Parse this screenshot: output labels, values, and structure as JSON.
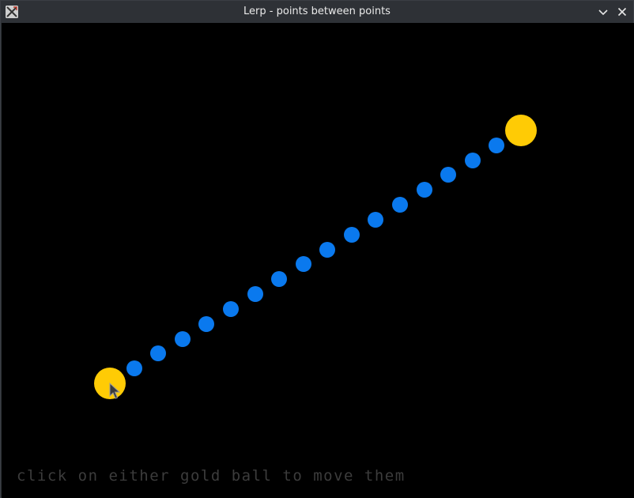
{
  "window": {
    "title": "Lerp - points between points"
  },
  "icons": {
    "app": "x11-app-icon",
    "minimize": "chevron-down-icon",
    "close": "close-icon"
  },
  "game": {
    "background_color": "#000000",
    "gold_color": "#ffcb05",
    "blue_color": "#0a79ee",
    "interpolated_point_count": 16,
    "hint_text": "click on either gold ball to move them",
    "hint_color": "#3c3c3c"
  }
}
